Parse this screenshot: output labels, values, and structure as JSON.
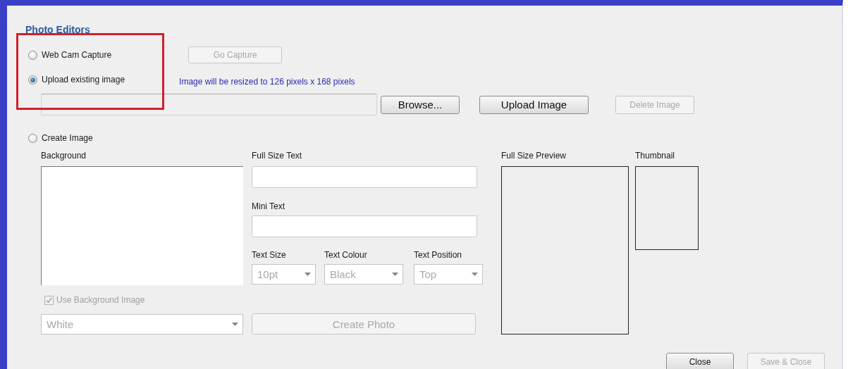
{
  "window": {
    "title": "Photo Editors"
  },
  "source_options": [
    {
      "label": "Web Cam Capture",
      "selected": false
    },
    {
      "label": "Upload existing image",
      "selected": true
    },
    {
      "label": "Create Image",
      "selected": false
    }
  ],
  "go_capture_button": {
    "label": "Go Capture",
    "disabled": true
  },
  "resize_note": "Image will be resized to 126 pixels x 168 pixels",
  "upload_buttons": [
    {
      "label": "Browse...",
      "disabled": false
    },
    {
      "label": "Upload Image",
      "disabled": false
    },
    {
      "label": "Delete Image",
      "disabled": true
    }
  ],
  "create_image": {
    "background_label": "Background",
    "full_size_text_label": "Full Size Text",
    "mini_text_label": "Mini Text",
    "selects": [
      {
        "label": "Text Size",
        "value": "10pt",
        "disabled": true
      },
      {
        "label": "Text Colour",
        "value": "Black",
        "disabled": true
      },
      {
        "label": "Text Position",
        "value": "Top",
        "disabled": true
      }
    ],
    "use_background_image": {
      "label": "Use Background Image",
      "checked": true,
      "disabled": true
    },
    "background_select": {
      "value": "White",
      "disabled": true
    },
    "create_photo_button": {
      "label": "Create Photo",
      "disabled": true
    },
    "preview_label": "Full Size Preview",
    "thumbnail_label": "Thumbnail"
  },
  "footer_buttons": [
    {
      "label": "Close",
      "disabled": false
    },
    {
      "label": "Save & Close",
      "disabled": true
    }
  ],
  "highlight_frame": true
}
